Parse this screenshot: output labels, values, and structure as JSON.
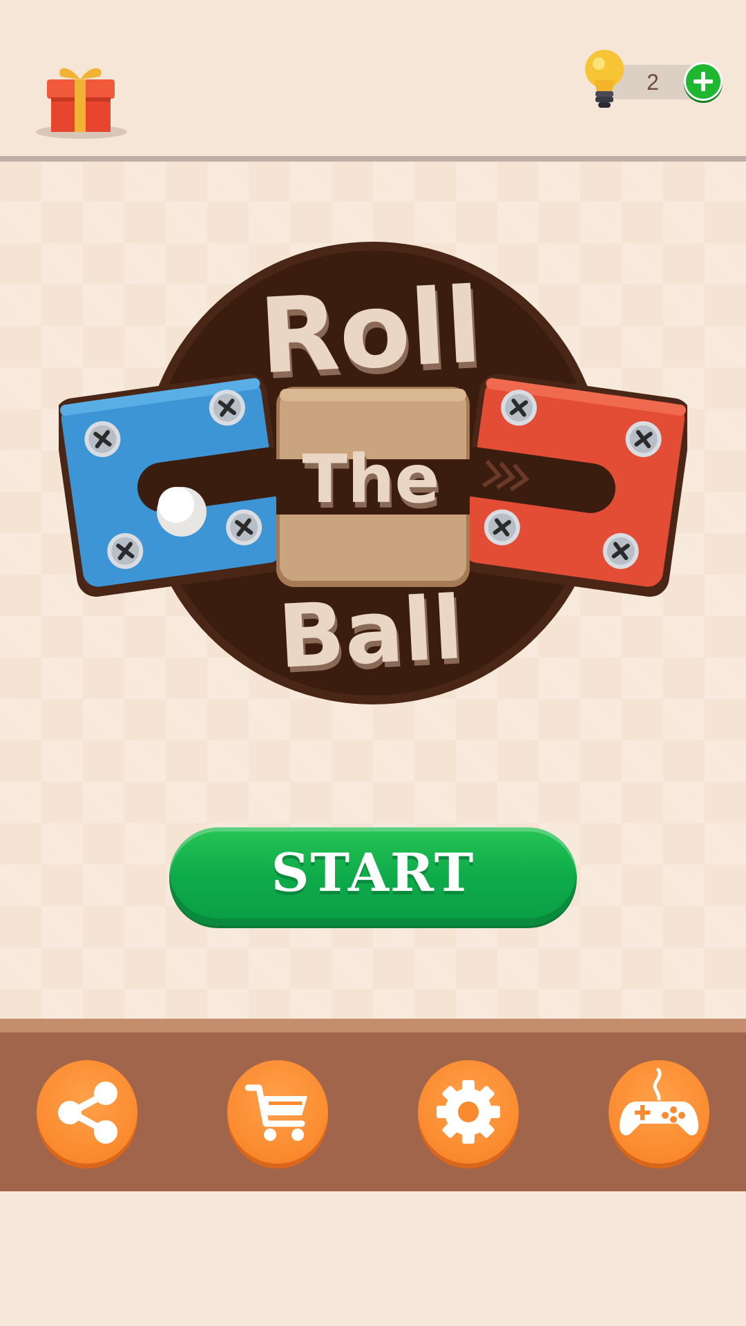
{
  "header": {
    "gift_icon": "gift-icon",
    "hint_icon": "lightbulb-icon",
    "hint_count": "2",
    "add_hint_icon": "plus-icon"
  },
  "logo": {
    "line1": "Roll",
    "line2": "The",
    "line3": "Ball"
  },
  "start_button": {
    "label": "START"
  },
  "bottom_nav": {
    "items": [
      {
        "icon": "share-icon"
      },
      {
        "icon": "cart-icon"
      },
      {
        "icon": "gear-icon"
      },
      {
        "icon": "gamepad-icon"
      }
    ]
  },
  "colors": {
    "background": "#f6e6d7",
    "start_green": "#12b04c",
    "nav_orange": "#fb8a2e",
    "nav_bar_brown": "#a1654b",
    "logo_dark_brown": "#3d1f12",
    "block_blue": "#3d95d5",
    "block_red": "#e44d35",
    "block_wood": "#c9a47f"
  }
}
